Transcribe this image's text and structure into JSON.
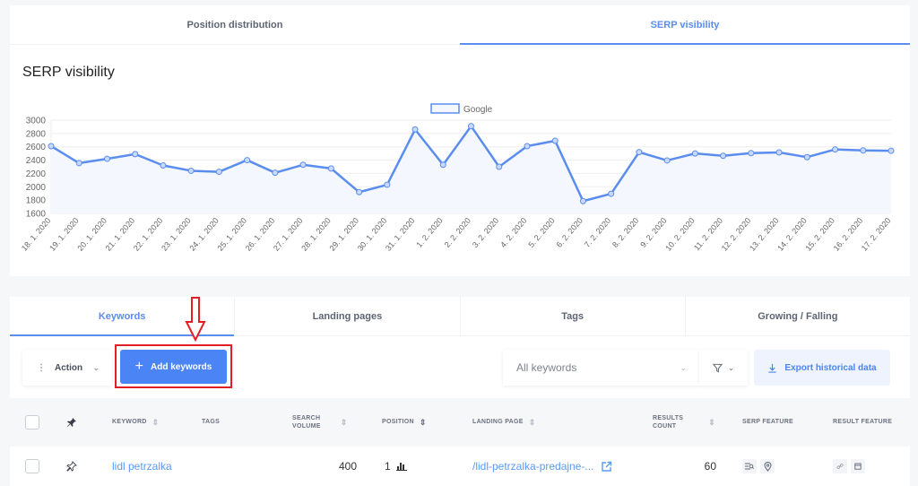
{
  "top_tabs": [
    {
      "label": "Position distribution",
      "active": false
    },
    {
      "label": "SERP visibility",
      "active": true
    }
  ],
  "section_title": "SERP visibility",
  "chart_data": {
    "type": "line",
    "title": "",
    "xlabel": "",
    "ylabel": "",
    "legend": {
      "labels": [
        "Google"
      ],
      "position": "top"
    },
    "ylim": [
      1600,
      3000
    ],
    "yticks": [
      1600,
      1800,
      2000,
      2200,
      2400,
      2600,
      2800,
      3000
    ],
    "grid": true,
    "fill": true,
    "colors": {
      "line": "#5a8dee",
      "fill": "#f4f7fe",
      "point_fill": "#c9dafc",
      "grid": "#eeeeee",
      "tick_text": "#666666"
    },
    "x": [
      "18. 1. 2020",
      "19. 1. 2020",
      "20. 1. 2020",
      "21. 1. 2020",
      "22. 1. 2020",
      "23. 1. 2020",
      "24. 1. 2020",
      "25. 1. 2020",
      "26. 1. 2020",
      "27. 1. 2020",
      "28. 1. 2020",
      "29. 1. 2020",
      "30. 1. 2020",
      "31. 1. 2020",
      "1. 2. 2020",
      "2. 2. 2020",
      "3. 2. 2020",
      "4. 2. 2020",
      "5. 2. 2020",
      "6. 2. 2020",
      "7. 2. 2020",
      "8. 2. 2020",
      "9. 2. 2020",
      "10. 2. 2020",
      "11. 2. 2020",
      "12. 2. 2020",
      "13. 2. 2020",
      "14. 2. 2020",
      "15. 2. 2020",
      "16. 2. 2020",
      "17. 2. 2020"
    ],
    "series": [
      {
        "name": "Google",
        "values": [
          2610,
          2355,
          2420,
          2490,
          2320,
          2240,
          2225,
          2400,
          2210,
          2330,
          2275,
          1920,
          2030,
          2860,
          2330,
          2910,
          2300,
          2610,
          2690,
          1785,
          1895,
          2520,
          2395,
          2500,
          2465,
          2505,
          2515,
          2445,
          2560,
          2545,
          2540
        ]
      }
    ]
  },
  "bottom_tabs": [
    {
      "label": "Keywords",
      "active": true
    },
    {
      "label": "Landing pages",
      "active": false
    },
    {
      "label": "Tags",
      "active": false
    },
    {
      "label": "Growing / Falling",
      "active": false
    }
  ],
  "toolbar": {
    "action_label": "Action",
    "add_keywords_label": "Add keywords",
    "keyword_filter_value": "All keywords",
    "export_label": "Export historical data"
  },
  "table": {
    "columns": {
      "keyword": "KEYWORD",
      "tags": "TAGS",
      "search_volume_1": "SEARCH",
      "search_volume_2": "VOLUME",
      "position": "POSITION",
      "landing_page": "LANDING PAGE",
      "results_count_1": "RESULTS",
      "results_count_2": "COUNT",
      "serp_feature": "SERP FEATURE",
      "result_feature": "RESULT FEATURE"
    },
    "rows": [
      {
        "keyword": "lidl petrzalka",
        "tags": "",
        "search_volume": "400",
        "position": "1",
        "landing_page": "/lidl-petrzalka-predajne-...",
        "results_count": "60",
        "serp_features": [
          "local-pack-icon",
          "map-pin-icon"
        ],
        "result_features": [
          "link-icon",
          "calendar-icon"
        ]
      }
    ]
  },
  "annotation": {
    "color": "#e41e26",
    "target": "Add keywords"
  }
}
